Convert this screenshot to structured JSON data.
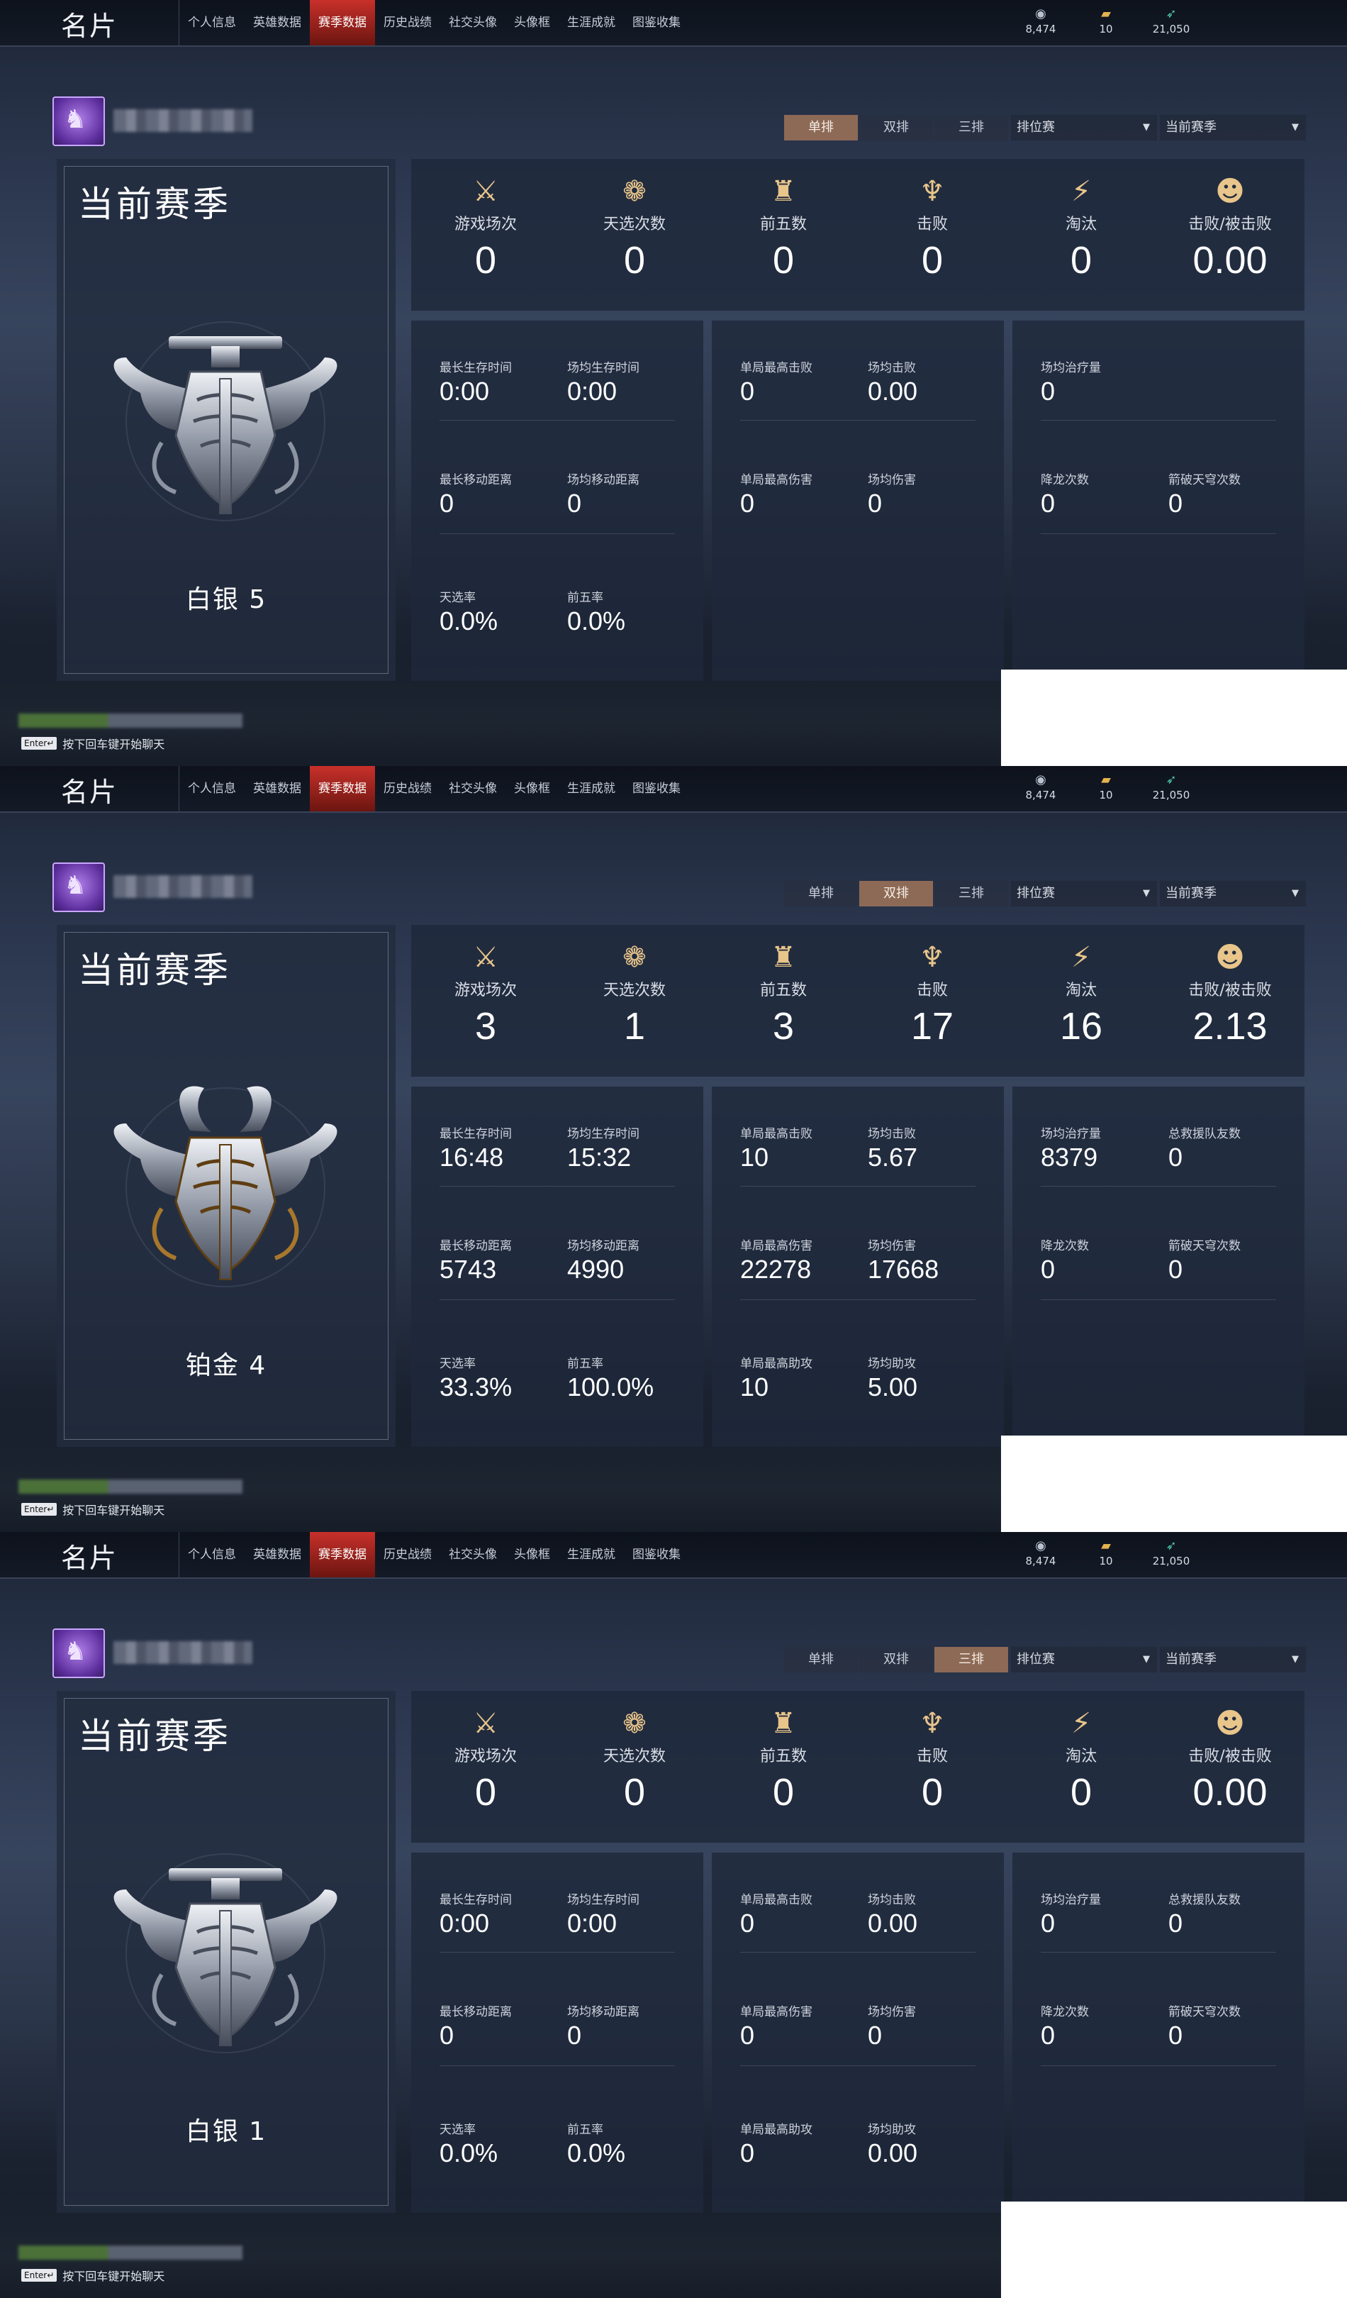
{
  "app_title": "名片",
  "nav": [
    "个人信息",
    "英雄数据",
    "赛季数据",
    "历史战绩",
    "社交头像",
    "头像框",
    "生涯成就",
    "图鉴收集"
  ],
  "active_nav": 2,
  "currencies": [
    {
      "icon": "coin-icon",
      "glyph": "◉",
      "value": "8,474"
    },
    {
      "icon": "ticket-icon",
      "glyph": "▰",
      "value": "10"
    },
    {
      "icon": "feather-icon",
      "glyph": "➶",
      "value": "21,050"
    }
  ],
  "mode_tabs": [
    "单排",
    "双排",
    "三排"
  ],
  "queue_dropdown": "排位赛",
  "season_dropdown": "当前赛季",
  "season_title": "当前赛季",
  "chat_hint": "按下回车键开始聊天",
  "enter_key": "Enter↵",
  "top_stat_labels": [
    "游戏场次",
    "天选次数",
    "前五数",
    "击败",
    "淘汰",
    "击败/被击败"
  ],
  "top_stat_icons": [
    {
      "name": "crossed-swords-icon",
      "glyph": "⚔"
    },
    {
      "name": "lotus-icon",
      "glyph": "❁"
    },
    {
      "name": "banner-icon",
      "glyph": "♜"
    },
    {
      "name": "trident-icon",
      "glyph": "♆"
    },
    {
      "name": "blade-icon",
      "glyph": "⚡"
    },
    {
      "name": "mask-icon",
      "glyph": "☻"
    }
  ],
  "labels": {
    "longest_survival": "最长生存时间",
    "avg_survival": "场均生存时间",
    "longest_move": "最长移动距离",
    "avg_move": "场均移动距离",
    "chosen_rate": "天选率",
    "top5_rate": "前五率",
    "max_kills": "单局最高击败",
    "avg_kills": "场均击败",
    "max_damage": "单局最高伤害",
    "avg_damage": "场均伤害",
    "max_assists": "单局最高助攻",
    "avg_assists": "场均助攻",
    "avg_heal": "场均治疗量",
    "total_rescue": "总救援队友数",
    "dragon": "降龙次数",
    "arrow": "箭破天穹次数"
  },
  "panels": [
    {
      "active_mode": 0,
      "rank": "白银 5",
      "emblem": "silver",
      "top_stats": [
        "0",
        "0",
        "0",
        "0",
        "0",
        "0.00"
      ],
      "a": {
        "longest_survival": "0:00",
        "avg_survival": "0:00",
        "longest_move": "0",
        "avg_move": "0",
        "chosen_rate": "0.0%",
        "top5_rate": "0.0%"
      },
      "b": {
        "max_kills": "0",
        "avg_kills": "0.00",
        "max_damage": "0",
        "avg_damage": "0"
      },
      "c": {
        "avg_heal": "0",
        "dragon": "0",
        "arrow": "0"
      }
    },
    {
      "active_mode": 1,
      "rank": "铂金 4",
      "emblem": "gold",
      "top_stats": [
        "3",
        "1",
        "3",
        "17",
        "16",
        "2.13"
      ],
      "a": {
        "longest_survival": "16:48",
        "avg_survival": "15:32",
        "longest_move": "5743",
        "avg_move": "4990",
        "chosen_rate": "33.3%",
        "top5_rate": "100.0%"
      },
      "b": {
        "max_kills": "10",
        "avg_kills": "5.67",
        "max_damage": "22278",
        "avg_damage": "17668",
        "max_assists": "10",
        "avg_assists": "5.00"
      },
      "c": {
        "avg_heal": "8379",
        "total_rescue": "0",
        "dragon": "0",
        "arrow": "0"
      }
    },
    {
      "active_mode": 2,
      "rank": "白银 1",
      "emblem": "silver",
      "top_stats": [
        "0",
        "0",
        "0",
        "0",
        "0",
        "0.00"
      ],
      "a": {
        "longest_survival": "0:00",
        "avg_survival": "0:00",
        "longest_move": "0",
        "avg_move": "0",
        "chosen_rate": "0.0%",
        "top5_rate": "0.0%"
      },
      "b": {
        "max_kills": "0",
        "avg_kills": "0.00",
        "max_damage": "0",
        "avg_damage": "0",
        "max_assists": "0",
        "avg_assists": "0.00"
      },
      "c": {
        "avg_heal": "0",
        "total_rescue": "0",
        "dragon": "0",
        "arrow": "0"
      }
    }
  ]
}
